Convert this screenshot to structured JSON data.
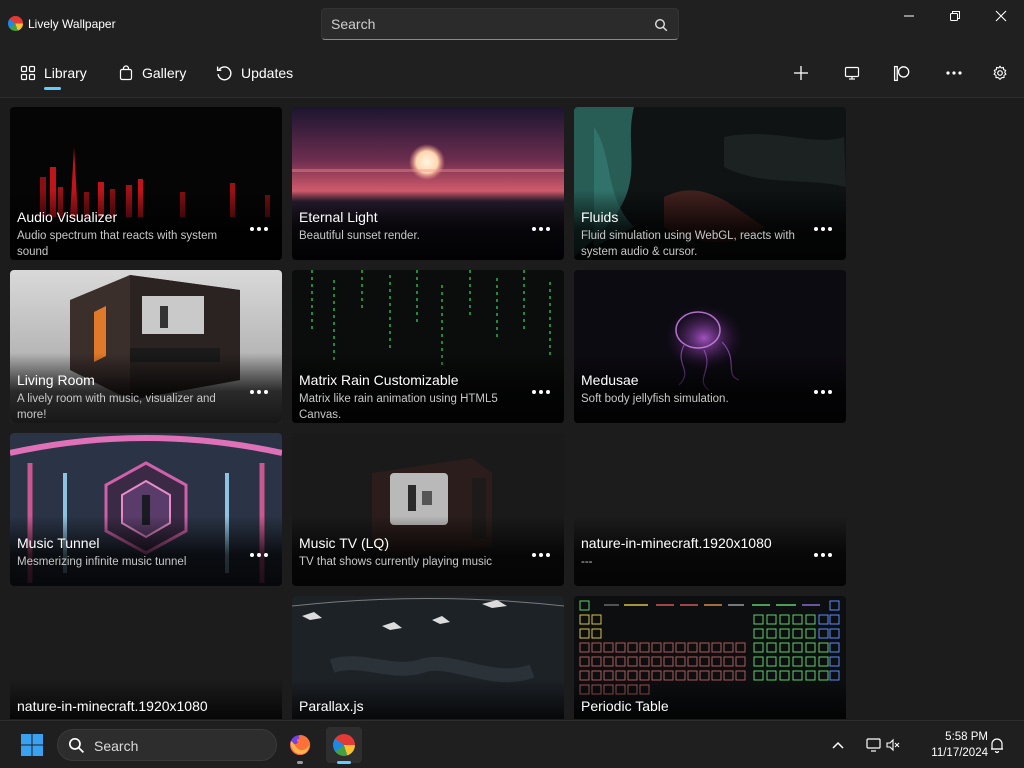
{
  "app": {
    "title": "Lively Wallpaper"
  },
  "search": {
    "placeholder": "Search"
  },
  "nav": {
    "library": "Library",
    "gallery": "Gallery",
    "updates": "Updates"
  },
  "more_glyph": "•••",
  "cards": [
    {
      "title": "Audio Visualizer",
      "desc": "Audio spectrum that reacts with system sound"
    },
    {
      "title": "Eternal Light",
      "desc": "Beautiful sunset render."
    },
    {
      "title": "Fluids",
      "desc": "Fluid simulation using WebGL, reacts with system audio & cursor."
    },
    {
      "title": "Living Room",
      "desc": "A lively room with music, visualizer and more!"
    },
    {
      "title": "Matrix Rain Customizable",
      "desc": "Matrix like rain animation using HTML5 Canvas."
    },
    {
      "title": "Medusae",
      "desc": "Soft body jellyfish simulation."
    },
    {
      "title": "Music Tunnel",
      "desc": "Mesmerizing infinite music tunnel"
    },
    {
      "title": "Music TV (LQ)",
      "desc": "TV that shows currently playing music"
    },
    {
      "title": "nature-in-minecraft.1920x1080",
      "desc": "---"
    },
    {
      "title": "nature-in-minecraft.1920x1080",
      "desc": ""
    },
    {
      "title": "Parallax.js",
      "desc": ""
    },
    {
      "title": "Periodic Table",
      "desc": ""
    }
  ],
  "taskbar": {
    "search_label": "Search",
    "time": "5:58 PM",
    "date": "11/17/2024"
  },
  "colors": {
    "accent": "#60cdff",
    "background": "#1c1c1c",
    "chrome": "#202020"
  }
}
